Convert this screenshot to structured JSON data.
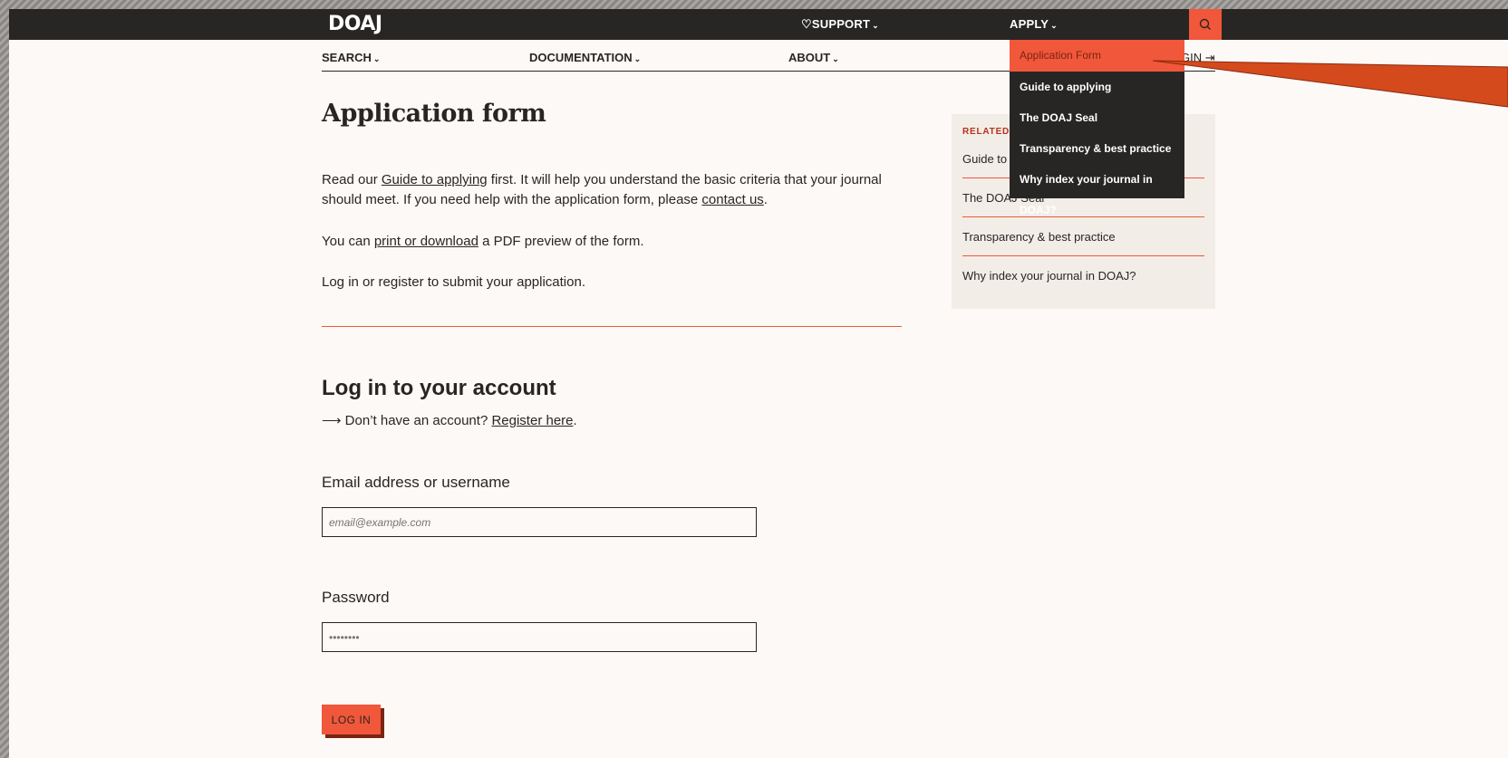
{
  "header": {
    "logo": "DOAJ",
    "nav": [
      {
        "label": "SUPPORT",
        "prefix_icon": "heart-icon"
      },
      {
        "label": "APPLY"
      }
    ],
    "search_icon": "search-icon"
  },
  "subnav": {
    "items": [
      "SEARCH",
      "DOCUMENTATION",
      "ABOUT"
    ],
    "login_label": "GIN"
  },
  "dropdown": {
    "items": [
      "Application Form",
      "Guide to applying",
      "The DOAJ Seal",
      "Transparency & best practice",
      "Why index your journal in DOAJ?"
    ],
    "active": "Application Form"
  },
  "main": {
    "title": "Application form",
    "p1_a": "Read our ",
    "p1_link1": "Guide to applying",
    "p1_b": " first. It will help you understand the basic criteria that your journal should meet. If you need help with the application form, please ",
    "p1_link2": "contact us",
    "p1_c": ".",
    "p2_a": "You can ",
    "p2_link": "print or download",
    "p2_b": " a PDF preview of the form.",
    "p3": "Log in or register to submit your application.",
    "login_title": "Log in to your account",
    "login_sub_a": "⟶ Don’t have an account? ",
    "login_sub_link": "Register here",
    "login_sub_b": ".",
    "email_label": "Email address or username",
    "email_placeholder": "email@example.com",
    "password_label": "Password",
    "password_placeholder": "••••••••",
    "login_button": "LOG IN"
  },
  "sidebar": {
    "heading": "RELATED H",
    "links": [
      "Guide to a",
      "The DOAJ Seal",
      "Transparency & best practice",
      "Why index your journal in DOAJ?"
    ]
  },
  "colors": {
    "accent": "#f1573a",
    "dark": "#282624",
    "background": "#fdf9f6",
    "arrow": "#d44a1c"
  }
}
